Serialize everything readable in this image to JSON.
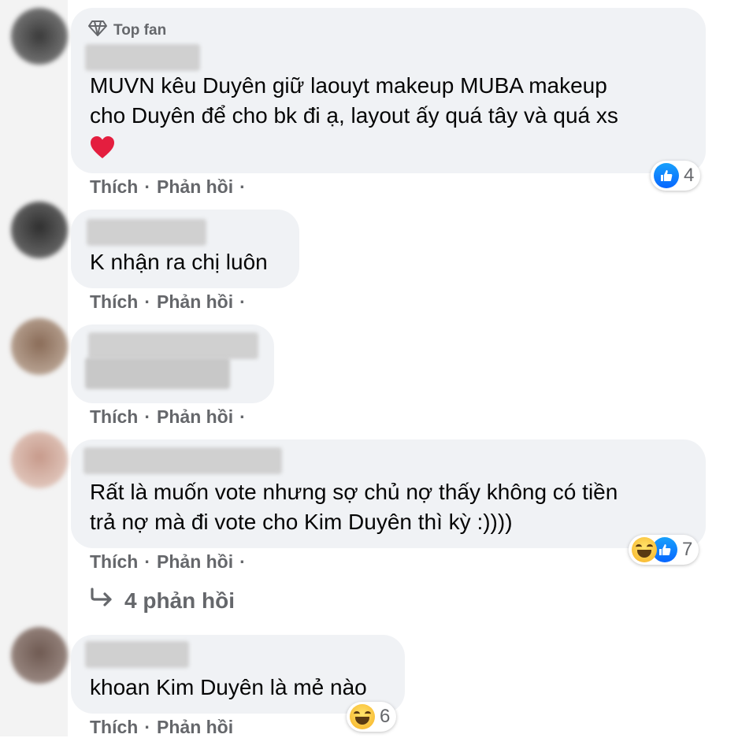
{
  "colors": {
    "bubble": "#f0f2f5",
    "meta_text": "#65676b",
    "like_blue": "#0866ff",
    "heart_red": "#e41e3f",
    "haha_yellow": "#f7b125"
  },
  "comments": [
    {
      "badge": "Top fan",
      "badge_icon": "diamond-icon",
      "text_lines": [
        "MUVN kêu Duyên giữ laouyt makeup MUBA makeup",
        "cho Duyên để cho bk đi ạ, layout ấy quá tây và quá xs"
      ],
      "emoji": "heart-icon",
      "reaction_count": "4",
      "reactions": [
        "like"
      ],
      "like_label": "Thích",
      "reply_label": "Phản hồi",
      "dot": "·"
    },
    {
      "text_lines": [
        "K nhận ra chị luôn"
      ],
      "like_label": "Thích",
      "reply_label": "Phản hồi",
      "dot": "·"
    },
    {
      "text_lines": [],
      "like_label": "Thích",
      "reply_label": "Phản hồi",
      "dot": "·"
    },
    {
      "text_lines": [
        "Rất là muốn vote nhưng sợ chủ nợ thấy không có tiền",
        "trả nợ mà đi vote cho Kim Duyên thì kỳ :))))"
      ],
      "reaction_count": "7",
      "reactions": [
        "haha",
        "like"
      ],
      "like_label": "Thích",
      "reply_label": "Phản hồi",
      "dot": "·"
    },
    {
      "text_lines": [
        "khoan Kim Duyên là mẻ nào"
      ],
      "reaction_count": "6",
      "reactions": [
        "haha"
      ],
      "like_label": "Thích",
      "reply_label": "Phản hồi",
      "dot": ""
    }
  ],
  "view_replies": {
    "label": "4 phản hồi",
    "icon": "reply-arrow-icon"
  }
}
